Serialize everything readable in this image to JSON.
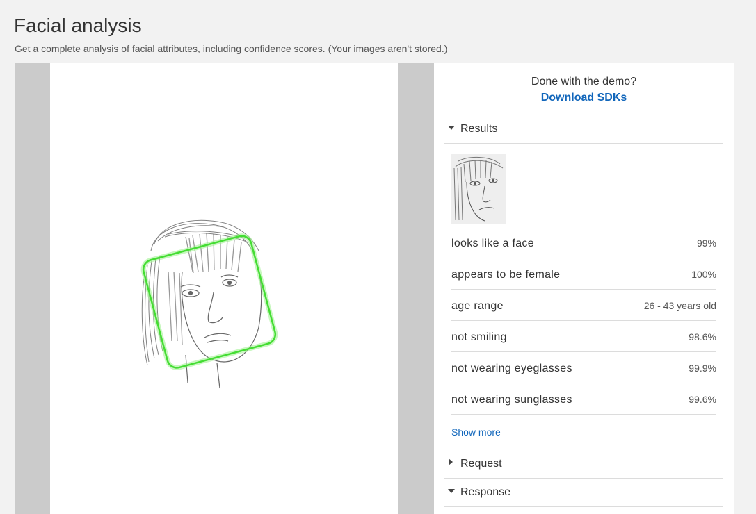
{
  "page": {
    "title": "Facial analysis",
    "subtitle": "Get a complete analysis of facial attributes, including confidence scores. (Your images aren't stored.)"
  },
  "demo": {
    "question": "Done with the demo?",
    "download_label": "Download SDKs"
  },
  "sections": {
    "results_label": "Results",
    "request_label": "Request",
    "response_label": "Response",
    "results_expanded": true,
    "request_expanded": false,
    "response_expanded": true
  },
  "results": {
    "attributes": [
      {
        "name": "looks like a face",
        "value": "99%"
      },
      {
        "name": "appears to be female",
        "value": "100%"
      },
      {
        "name": "age range",
        "value": "26 - 43 years old"
      },
      {
        "name": "not smiling",
        "value": "98.6%"
      },
      {
        "name": "not wearing eyeglasses",
        "value": "99.9%"
      },
      {
        "name": "not wearing sunglasses",
        "value": "99.6%"
      }
    ],
    "show_more_label": "Show more"
  },
  "colors": {
    "link": "#1166bb",
    "face_box": "#44dd33",
    "panel_gray": "#cbcbcb"
  }
}
